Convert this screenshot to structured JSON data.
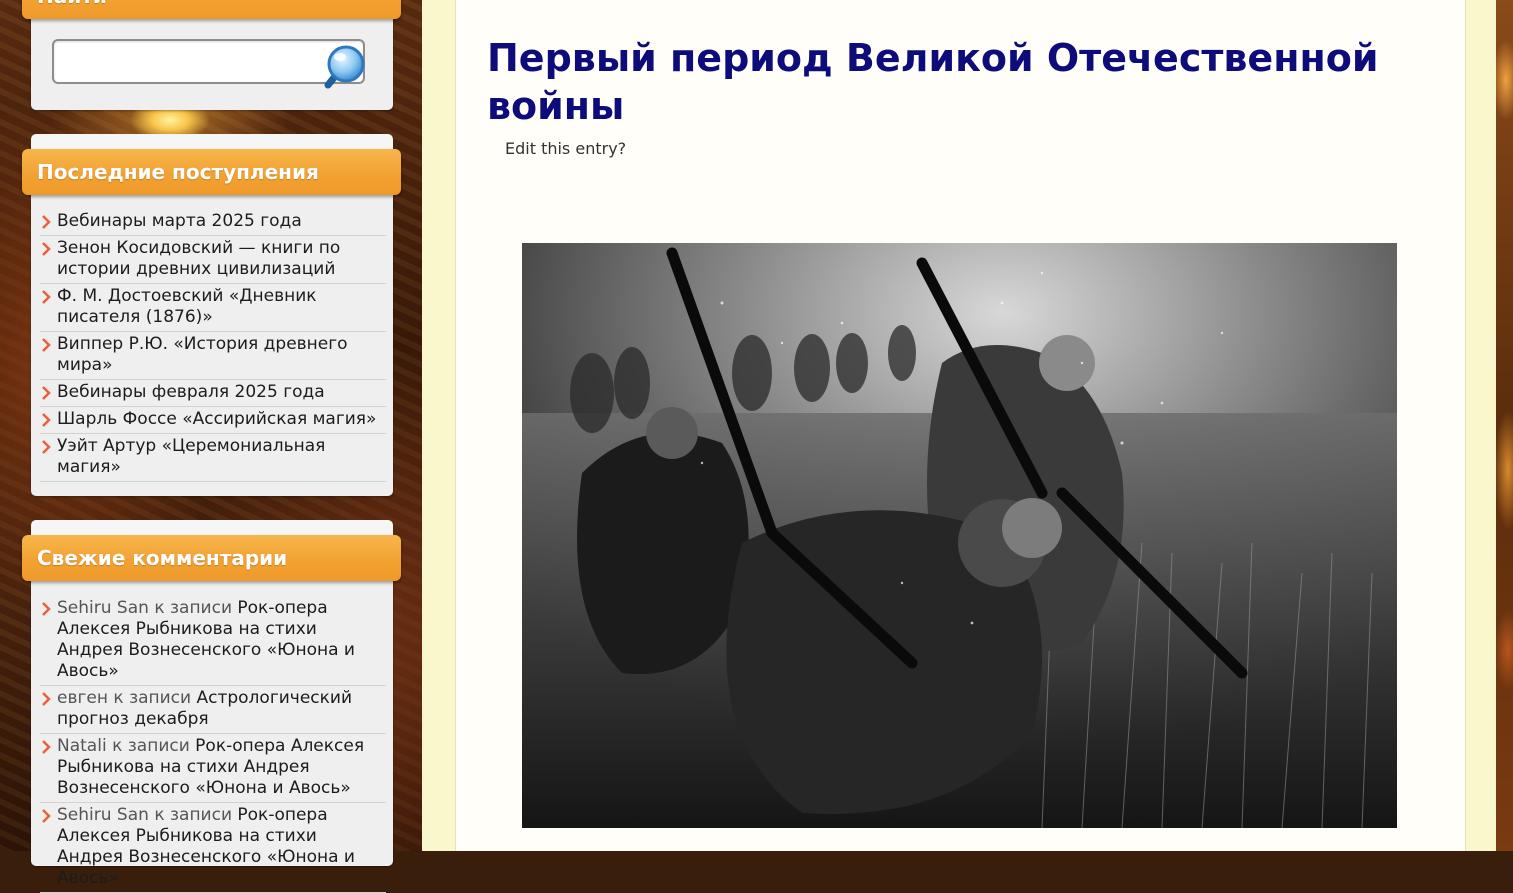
{
  "search": {
    "header": "Найти",
    "value": "",
    "placeholder": "",
    "button_icon": "magnifier-icon"
  },
  "recent_posts": {
    "title": "Последние поступления",
    "items": [
      "Вебинары марта 2025 года",
      "Зенон Косидовский — книги по истории древних цивилизаций",
      "Ф. М. Достоевский «Дневник писателя (1876)»",
      "Виппер Р.Ю. «История древнего мира»",
      "Вебинары февраля 2025 года",
      "Шарль Фоссе «Ассирийская магия»",
      "Уэйт Артур «Церемониальная магия»"
    ]
  },
  "recent_comments": {
    "title": "Свежие комментарии",
    "items": [
      {
        "author": "Sehiru San",
        "sep": "к записи",
        "post": "Рок-опера Алексея Рыбникова на стихи Андрея Вознесенского «Юнона и Авось»"
      },
      {
        "author": "евген",
        "sep": "к записи",
        "post": "Астрологический прогноз декабря"
      },
      {
        "author": "Natali",
        "sep": "к записи",
        "post": "Рок-опера Алексея Рыбникова на стихи Андрея Вознесенского «Юнона и Авось»"
      },
      {
        "author": "Sehiru San",
        "sep": "к записи",
        "post": "Рок-опера Алексея Рыбникова на стихи Андрея Вознесенского «Юнона и Авось»"
      }
    ]
  },
  "post": {
    "title": "Первый период Великой Отечественной войны",
    "edit_link": "Edit this entry?",
    "image_description_icon": "war-photo-image"
  },
  "colors": {
    "widget_header": "#f2a233",
    "title": "#0d0c7a",
    "arrow": "#e8613a",
    "content_bg": "#fffef9",
    "gutter_bg": "#fbf7cc"
  }
}
